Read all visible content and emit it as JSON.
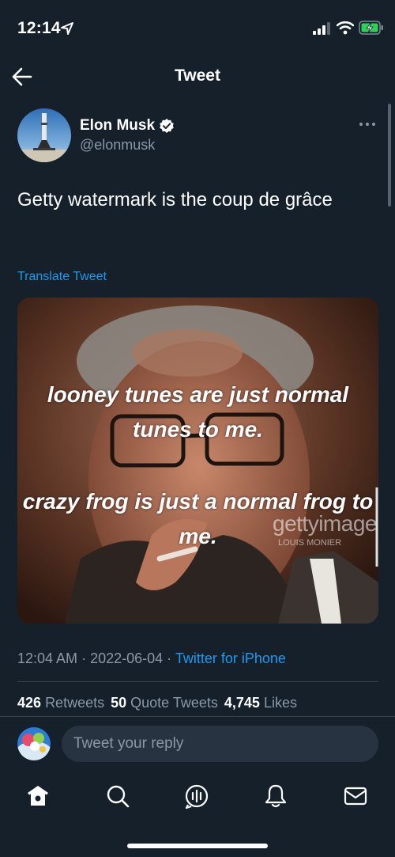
{
  "status_bar": {
    "time": "12:14",
    "icons": [
      "location-arrow-icon",
      "signal-icon",
      "wifi-icon",
      "battery-charging-icon"
    ]
  },
  "nav": {
    "title": "Tweet",
    "back_icon": "arrow-left-icon"
  },
  "tweet": {
    "author": {
      "name": "Elon Musk",
      "handle": "@elonmusk",
      "verified_icon": "verified-badge-icon"
    },
    "more_icon": "ellipsis-icon",
    "text": "Getty watermark is the coup de grâce",
    "translate_label": "Translate Tweet",
    "media": {
      "caption_line1": "looney tunes are just normal tunes to me.",
      "caption_line2": "crazy frog is just a normal frog to me.",
      "watermark": "gettyimage",
      "watermark_sub": "LOUIS MONIER"
    },
    "meta": {
      "time": "12:04 AM",
      "separator": " · ",
      "date": "2022-06-04",
      "source": "Twitter for iPhone"
    },
    "stats": {
      "retweets_count": "426",
      "retweets_label": "Retweets",
      "quote_count": "50",
      "quote_label": "Quote Tweets",
      "likes_count": "4,745",
      "likes_label": "Likes"
    }
  },
  "reply": {
    "placeholder": "Tweet your reply"
  },
  "tab_bar": {
    "tabs": [
      "home-icon",
      "search-icon",
      "spaces-icon",
      "notifications-bell-icon",
      "messages-envelope-icon"
    ],
    "active": "home-icon"
  },
  "colors": {
    "background": "#15202b",
    "link": "#1d9bf0",
    "secondary_text": "#8b98a5",
    "divider": "#38444d"
  }
}
